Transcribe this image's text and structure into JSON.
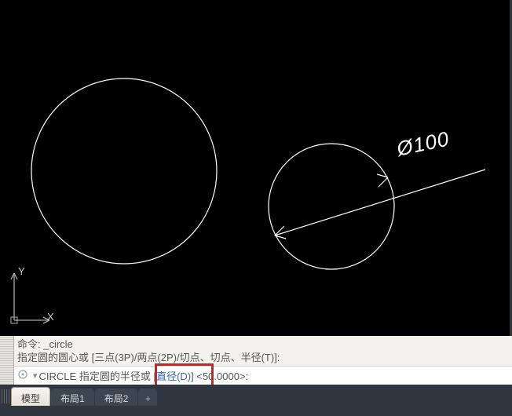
{
  "canvas": {
    "dimension_label": "Ø100",
    "ucs_x": "X",
    "ucs_y": "Y"
  },
  "command_history": {
    "line1": "命令: _circle",
    "line2_pre": "指定圆的圆心或 [",
    "line2_opts": "三点(3P)/两点(2P)/切点、切点、半径(T)",
    "line2_post": "]:"
  },
  "command_input": {
    "keyword": "CIRCLE",
    "prompt_pre": " 指定圆的半径或 ",
    "bracket_open": "[",
    "option": "直径(D)",
    "bracket_close": "]",
    "default": " <50.0000>:"
  },
  "tabs": {
    "model": "模型",
    "layout1": "布局1",
    "layout2": "布局2",
    "add": "+"
  }
}
